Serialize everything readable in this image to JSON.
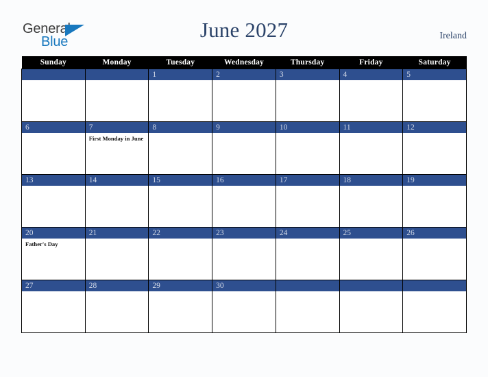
{
  "brand": {
    "name_part1": "General",
    "name_part2": "Blue",
    "accent_color": "#1878be",
    "text_color": "#3b3b3b"
  },
  "header": {
    "title": "June 2027",
    "region": "Ireland",
    "title_color": "#2b4369"
  },
  "calendar": {
    "weekday_headers": [
      "Sunday",
      "Monday",
      "Tuesday",
      "Wednesday",
      "Thursday",
      "Friday",
      "Saturday"
    ],
    "header_bg": "#000000",
    "date_bar_bg": "#2e4f8f",
    "date_text_color": "#d5dbe8",
    "weeks": [
      [
        {
          "date": "",
          "events": []
        },
        {
          "date": "",
          "events": []
        },
        {
          "date": "1",
          "events": []
        },
        {
          "date": "2",
          "events": []
        },
        {
          "date": "3",
          "events": []
        },
        {
          "date": "4",
          "events": []
        },
        {
          "date": "5",
          "events": []
        }
      ],
      [
        {
          "date": "6",
          "events": []
        },
        {
          "date": "7",
          "events": [
            "First Monday in June"
          ]
        },
        {
          "date": "8",
          "events": []
        },
        {
          "date": "9",
          "events": []
        },
        {
          "date": "10",
          "events": []
        },
        {
          "date": "11",
          "events": []
        },
        {
          "date": "12",
          "events": []
        }
      ],
      [
        {
          "date": "13",
          "events": []
        },
        {
          "date": "14",
          "events": []
        },
        {
          "date": "15",
          "events": []
        },
        {
          "date": "16",
          "events": []
        },
        {
          "date": "17",
          "events": []
        },
        {
          "date": "18",
          "events": []
        },
        {
          "date": "19",
          "events": []
        }
      ],
      [
        {
          "date": "20",
          "events": [
            "Father's Day"
          ]
        },
        {
          "date": "21",
          "events": []
        },
        {
          "date": "22",
          "events": []
        },
        {
          "date": "23",
          "events": []
        },
        {
          "date": "24",
          "events": []
        },
        {
          "date": "25",
          "events": []
        },
        {
          "date": "26",
          "events": []
        }
      ],
      [
        {
          "date": "27",
          "events": []
        },
        {
          "date": "28",
          "events": []
        },
        {
          "date": "29",
          "events": []
        },
        {
          "date": "30",
          "events": []
        },
        {
          "date": "",
          "events": []
        },
        {
          "date": "",
          "events": []
        },
        {
          "date": "",
          "events": []
        }
      ]
    ]
  }
}
